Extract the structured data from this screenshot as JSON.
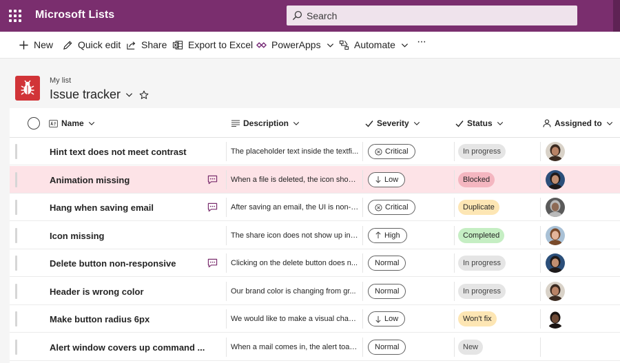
{
  "suite": {
    "app_title": "Microsoft Lists",
    "search_placeholder": "Search"
  },
  "commands": {
    "new": "New",
    "quick_edit": "Quick edit",
    "share": "Share",
    "export": "Export to Excel",
    "powerapps": "PowerApps",
    "automate": "Automate",
    "more": "···"
  },
  "list": {
    "breadcrumb": "My list",
    "title": "Issue tracker"
  },
  "columns": {
    "name": "Name",
    "description": "Description",
    "severity": "Severity",
    "status": "Status",
    "assigned": "Assigned to"
  },
  "status_colors": {
    "In progress": {
      "bg": "#e5e5e5",
      "fg": "#424242"
    },
    "Blocked": {
      "bg": "#f4b6c0",
      "fg": "#242424"
    },
    "Duplicate": {
      "bg": "#fde6b4",
      "fg": "#242424"
    },
    "Completed": {
      "bg": "#c5eec3",
      "fg": "#242424"
    },
    "Won't fix": {
      "bg": "#fde6b4",
      "fg": "#242424"
    },
    "New": {
      "bg": "#e5e5e5",
      "fg": "#424242"
    }
  },
  "rows": [
    {
      "name": "Hint text does not meet contrast",
      "comment": false,
      "description": "The placeholder text inside the textfi...",
      "severity": "Critical",
      "severity_icon": "circle-x-icon",
      "status": "In progress",
      "avatar": {
        "skin": "#b98366",
        "hair": "#3b2a20",
        "bg": "#d9d2c8"
      }
    },
    {
      "name": "Animation missing",
      "comment": true,
      "description": "When a file is deleted, the icon shoul...",
      "severity": "Low",
      "severity_icon": "arrow-down-icon",
      "status": "Blocked",
      "avatar": {
        "skin": "#c08e70",
        "hair": "#1e1a1a",
        "bg": "#2b4f7a"
      },
      "selected": true
    },
    {
      "name": "Hang when saving email",
      "comment": true,
      "description": "After saving an email, the UI is non-r...",
      "severity": "Critical",
      "severity_icon": "circle-x-icon",
      "status": "Duplicate",
      "avatar": {
        "skin": "#8d6a55",
        "hair": "#b9b9b9",
        "bg": "#5a5a5a"
      }
    },
    {
      "name": "Icon missing",
      "comment": false,
      "description": "The share icon does not show up in t...",
      "severity": "High",
      "severity_icon": "arrow-up-icon",
      "status": "Completed",
      "avatar": {
        "skin": "#e3b59a",
        "hair": "#7a4a2a",
        "bg": "#a9c1d6"
      }
    },
    {
      "name": "Delete button non-responsive",
      "comment": true,
      "description": "Clicking on the delete button does n...",
      "severity": "Normal",
      "severity_icon": "",
      "status": "In progress",
      "avatar": {
        "skin": "#c08e70",
        "hair": "#1e1a1a",
        "bg": "#2b4f7a"
      }
    },
    {
      "name": "Header is wrong color",
      "comment": false,
      "description": "Our brand color is changing from gr...",
      "severity": "Normal",
      "severity_icon": "",
      "status": "In progress",
      "avatar": {
        "skin": "#b98366",
        "hair": "#3b2a20",
        "bg": "#d9d2c8"
      }
    },
    {
      "name": "Make button radius 6px",
      "comment": false,
      "description": "We would like to make a visual chan...",
      "severity": "Low",
      "severity_icon": "arrow-down-icon",
      "status": "Won't fix",
      "avatar": {
        "skin": "#6e4a36",
        "hair": "#1a1412",
        "bg": "#ffffff"
      }
    },
    {
      "name": "Alert window covers up command ...",
      "comment": false,
      "description": "When a mail comes in, the alert toast...",
      "severity": "Normal",
      "severity_icon": "",
      "status": "New",
      "avatar": null
    }
  ]
}
